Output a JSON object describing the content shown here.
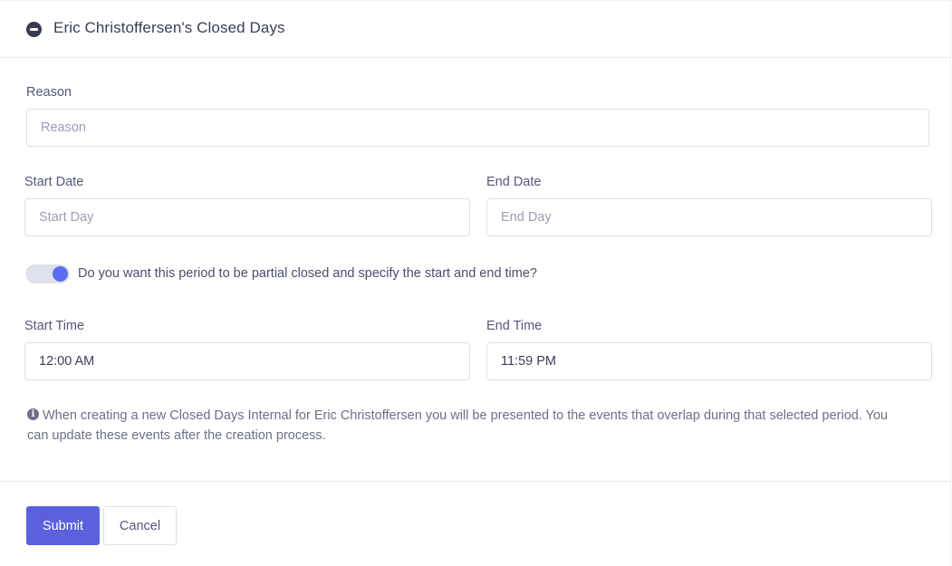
{
  "header": {
    "title": "Eric Christoffersen's Closed Days",
    "icon": "minus-circle-icon"
  },
  "form": {
    "reason": {
      "label": "Reason",
      "placeholder": "Reason",
      "value": ""
    },
    "start_date": {
      "label": "Start Date",
      "placeholder": "Start Day",
      "value": ""
    },
    "end_date": {
      "label": "End Date",
      "placeholder": "End Day",
      "value": ""
    },
    "partial_toggle": {
      "label": "Do you want this period to be partial closed and specify the start and end time?",
      "checked": true,
      "color": "#5b6ef0"
    },
    "start_time": {
      "label": "Start Time",
      "value": "12:00 AM"
    },
    "end_time": {
      "label": "End Time",
      "value": "11:59 PM"
    },
    "info": {
      "icon": "info-icon",
      "text": "When creating a new Closed Days Internal for Eric Christoffersen you will be presented to the events that overlap during that selected period. You can update these events after the creation process."
    }
  },
  "footer": {
    "submit_label": "Submit",
    "cancel_label": "Cancel",
    "submit_color": "#5b61dc"
  }
}
